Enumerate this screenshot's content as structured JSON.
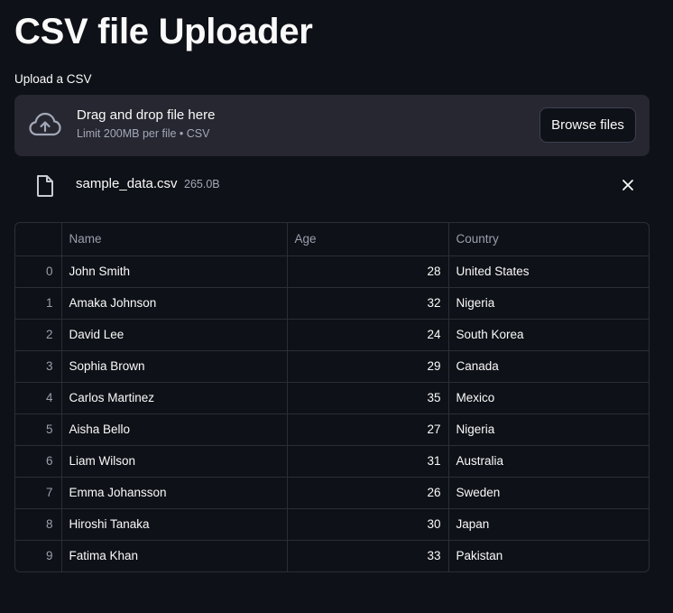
{
  "page": {
    "title": "CSV file Uploader"
  },
  "uploader": {
    "label": "Upload a CSV",
    "dropzone_title": "Drag and drop file here",
    "dropzone_limit": "Limit 200MB per file • CSV",
    "browse_label": "Browse files",
    "icon": "cloud-upload-icon"
  },
  "file": {
    "name": "sample_data.csv",
    "size": "265.0B",
    "icon": "file-icon",
    "remove_icon": "close-icon"
  },
  "table": {
    "columns": [
      "",
      "Name",
      "Age",
      "Country"
    ],
    "rows": [
      {
        "index": "0",
        "name": "John Smith",
        "age": "28",
        "country": "United States"
      },
      {
        "index": "1",
        "name": "Amaka Johnson",
        "age": "32",
        "country": "Nigeria"
      },
      {
        "index": "2",
        "name": "David Lee",
        "age": "24",
        "country": "South Korea"
      },
      {
        "index": "3",
        "name": "Sophia Brown",
        "age": "29",
        "country": "Canada"
      },
      {
        "index": "4",
        "name": "Carlos Martinez",
        "age": "35",
        "country": "Mexico"
      },
      {
        "index": "5",
        "name": "Aisha Bello",
        "age": "27",
        "country": "Nigeria"
      },
      {
        "index": "6",
        "name": "Liam Wilson",
        "age": "31",
        "country": "Australia"
      },
      {
        "index": "7",
        "name": "Emma Johansson",
        "age": "26",
        "country": "Sweden"
      },
      {
        "index": "8",
        "name": "Hiroshi Tanaka",
        "age": "30",
        "country": "Japan"
      },
      {
        "index": "9",
        "name": "Fatima Khan",
        "age": "33",
        "country": "Pakistan"
      }
    ]
  },
  "colors": {
    "background": "#0e1117",
    "dropzone": "#262730",
    "text": "#fafafa",
    "muted_text": "#a3a8b8",
    "border": "#2b2e38"
  }
}
